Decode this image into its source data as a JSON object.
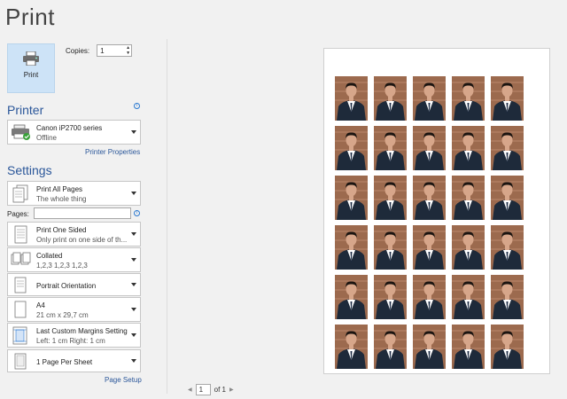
{
  "title": "Print",
  "print_button": {
    "label": "Print",
    "icon": "printer-icon"
  },
  "copies": {
    "label": "Copies:",
    "value": "1"
  },
  "printer": {
    "heading": "Printer",
    "name": "Canon iP2700 series",
    "status": "Offline",
    "properties_link": "Printer Properties"
  },
  "settings": {
    "heading": "Settings",
    "pages_label": "Pages:",
    "pages_value": "",
    "items": [
      {
        "title": "Print All Pages",
        "sub": "The whole thing",
        "icon": "pages-icon"
      },
      {
        "title": "Print One Sided",
        "sub": "Only print on one side of th...",
        "icon": "one-sided-icon"
      },
      {
        "title": "Collated",
        "sub": "1,2,3    1,2,3    1,2,3",
        "icon": "collated-icon"
      },
      {
        "title": "Portrait Orientation",
        "sub": "",
        "icon": "portrait-icon"
      },
      {
        "title": "A4",
        "sub": "21 cm x 29,7 cm",
        "icon": "paper-size-icon"
      },
      {
        "title": "Last Custom Margins Setting",
        "sub": "Left:  1 cm    Right:  1 cm",
        "icon": "margins-icon"
      },
      {
        "title": "1 Page Per Sheet",
        "sub": "",
        "icon": "pages-per-sheet-icon"
      }
    ],
    "page_setup_link": "Page Setup"
  },
  "preview": {
    "rows": 6,
    "cols": 5,
    "photo_desc": "passport-photo",
    "colors": {
      "bg": "#9c6a4e",
      "suit": "#1e2a3a",
      "skin": "#d7a68a",
      "hair": "#1b1410",
      "shirt": "#ffffff",
      "tie": "#1a2a44"
    }
  },
  "navigation": {
    "page": "1",
    "of_label": "of 1"
  }
}
